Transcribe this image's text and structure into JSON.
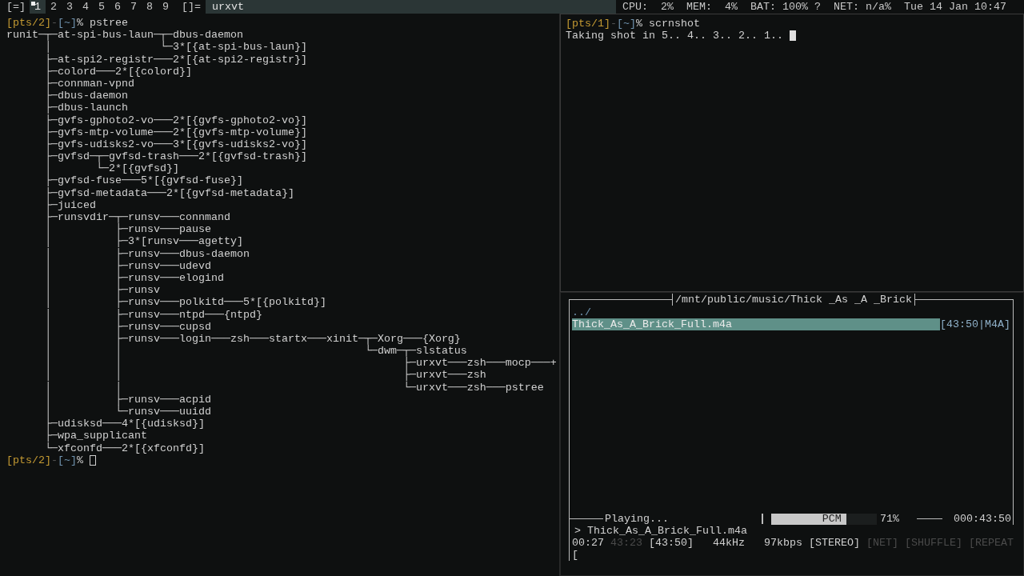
{
  "bar": {
    "layout_left": "[=]",
    "tags": [
      {
        "label": "1",
        "selected": true,
        "occupied": true
      },
      {
        "label": "2",
        "selected": false,
        "occupied": false
      },
      {
        "label": "3",
        "selected": false,
        "occupied": false
      },
      {
        "label": "4",
        "selected": false,
        "occupied": false
      },
      {
        "label": "5",
        "selected": false,
        "occupied": false
      },
      {
        "label": "6",
        "selected": false,
        "occupied": false
      },
      {
        "label": "7",
        "selected": false,
        "occupied": false
      },
      {
        "label": "8",
        "selected": false,
        "occupied": false
      },
      {
        "label": "9",
        "selected": false,
        "occupied": false
      }
    ],
    "layout_symbol": "[]=",
    "window_title": "urxvt",
    "status": [
      "CPU:  2%",
      "MEM:  4%",
      "BAT: 100% ?",
      "NET: n/a%",
      "Tue 14 Jan 10:47"
    ]
  },
  "terminals": [
    {
      "focused": false,
      "prompt": {
        "tty": "[pts/2]",
        "sep": "-",
        "dir": "[~]",
        "symbol": "%"
      },
      "command": "pstree",
      "output": [
        "runit─┬─at-spi-bus-laun─┬─dbus-daemon",
        "      │                 └─3*[{at-spi-bus-laun}]",
        "      ├─at-spi2-registr───2*[{at-spi2-registr}]",
        "      ├─colord───2*[{colord}]",
        "      ├─connman-vpnd",
        "      ├─dbus-daemon",
        "      ├─dbus-launch",
        "      ├─gvfs-gphoto2-vo───2*[{gvfs-gphoto2-vo}]",
        "      ├─gvfs-mtp-volume───2*[{gvfs-mtp-volume}]",
        "      ├─gvfs-udisks2-vo───3*[{gvfs-udisks2-vo}]",
        "      ├─gvfsd─┬─gvfsd-trash───2*[{gvfsd-trash}]",
        "      │       └─2*[{gvfsd}]",
        "      ├─gvfsd-fuse───5*[{gvfsd-fuse}]",
        "      ├─gvfsd-metadata───2*[{gvfsd-metadata}]",
        "      ├─juiced",
        "      ├─runsvdir─┬─runsv───connmand",
        "      │          ├─runsv───pause",
        "      │          ├─3*[runsv───agetty]",
        "      │          ├─runsv───dbus-daemon",
        "      │          ├─runsv───udevd",
        "      │          ├─runsv───elogind",
        "      │          ├─runsv",
        "      │          ├─runsv───polkitd───5*[{polkitd}]",
        "      │          ├─runsv───ntpd───{ntpd}",
        "      │          ├─runsv───cupsd",
        "      │          ├─runsv───login───zsh───startx───xinit─┬─Xorg───{Xorg}",
        "      │          │                                      └─dwm─┬─slstatus",
        "      │          │                                            ├─urxvt───zsh───mocp───+",
        "      │          │                                            ├─urxvt───zsh",
        "      │          │                                            └─urxvt───zsh───pstree",
        "      │          ├─runsv───acpid",
        "      │          └─runsv───uuidd",
        "      ├─udisksd───4*[{udisksd}]",
        "      ├─wpa_supplicant",
        "      └─xfconfd───2*[{xfconfd}]"
      ],
      "final_prompt": {
        "tty": "[pts/2]",
        "sep": "-",
        "dir": "[~]",
        "symbol": "%"
      }
    },
    {
      "focused": true,
      "prompt": {
        "tty": "[pts/1]",
        "sep": "-",
        "dir": "[~]",
        "symbol": "%"
      },
      "command": "scrnshot",
      "output": [
        "Taking shot in 5.. 4.. 3.. 2.. 1.. "
      ]
    }
  ],
  "player": {
    "title": "/mnt/public/music/Thick _As _A _Brick",
    "files": [
      {
        "name": "../",
        "kind": "dir",
        "selected": false
      },
      {
        "name": "Thick_As_A_Brick_Full.m4a",
        "kind": "file",
        "info": "[43:50|M4A]",
        "selected": true
      }
    ],
    "state": "Playing...",
    "mixer": {
      "label": "PCM",
      "level": 0.71,
      "reading": "71%"
    },
    "total": "000:43:50",
    "current": "> Thick_As_A_Brick_Full.m4a",
    "elapsed": "00:27",
    "remaining": "43:23",
    "length": "[43:50]",
    "rate": "44kHz",
    "bitrate": "97kbps",
    "flags": [
      {
        "label": "[STEREO]",
        "on": true
      },
      {
        "label": "[NET]",
        "on": false
      },
      {
        "label": "[SHUFFLE]",
        "on": false
      },
      {
        "label": "[REPEAT",
        "on": false
      }
    ],
    "progress": "["
  }
}
